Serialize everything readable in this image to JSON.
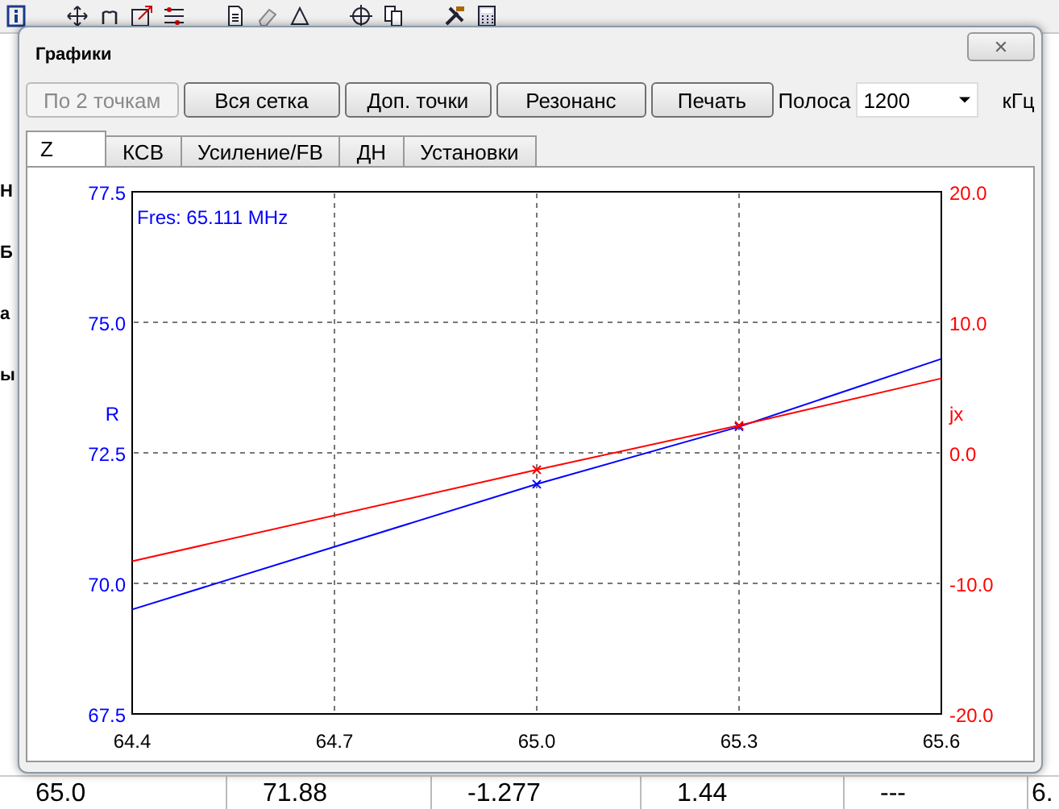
{
  "background": {
    "side_fragments": [
      "Н",
      "Б",
      "а",
      "ы"
    ],
    "bottom_row": [
      "65.0",
      "71.88",
      "-1.277",
      "1.44",
      "---",
      "6."
    ]
  },
  "window": {
    "title": "Графики",
    "close": "✕"
  },
  "toolbar": {
    "buttons": [
      {
        "label": "По 2 точкам",
        "disabled": true
      },
      {
        "label": "Вся сетка",
        "disabled": false
      },
      {
        "label": "Доп. точки",
        "disabled": false
      },
      {
        "label": "Резонанс",
        "disabled": false
      },
      {
        "label": "Печать",
        "disabled": false
      }
    ],
    "band_label": "Полоса",
    "band_value": "1200",
    "band_unit": "кГц"
  },
  "tabs": [
    {
      "label": "Z",
      "selected": true
    },
    {
      "label": "КСВ",
      "selected": false
    },
    {
      "label": "Усиление/FB",
      "selected": false
    },
    {
      "label": "ДН",
      "selected": false
    },
    {
      "label": "Установки",
      "selected": false
    }
  ],
  "chart_data": {
    "type": "line",
    "grid": true,
    "x": [
      64.4,
      65.0,
      65.3,
      65.6
    ],
    "xlim": [
      64.4,
      65.6
    ],
    "xticks": [
      64.4,
      64.7,
      {
        "value": 65,
        "label": "65.0"
      },
      65.3,
      65.6
    ],
    "ylim": [
      67.5,
      77.5
    ],
    "yticks": [
      67.5,
      {
        "value": 70,
        "label": "70.0"
      },
      72.5,
      {
        "value": 75,
        "label": "75.0"
      },
      77.5
    ],
    "y2lim": [
      -20,
      20
    ],
    "y2ticks": [
      {
        "value": -20,
        "label": "-20.0"
      },
      {
        "value": -10,
        "label": "-10.0"
      },
      {
        "value": 0,
        "label": "0.0"
      },
      {
        "value": 10,
        "label": "10.0"
      },
      {
        "value": 20,
        "label": "20.0"
      }
    ],
    "series": [
      {
        "name": "R",
        "color": "#0000ff",
        "values": [
          69.5,
          71.9,
          73.0,
          74.3
        ]
      },
      {
        "name": "jx",
        "color": "#ff0000",
        "axis": "y2",
        "values": [
          -8.3,
          -1.3,
          2.1,
          5.7
        ]
      }
    ],
    "annotations": [
      {
        "text": "Fres: 65.111 MHz"
      }
    ]
  }
}
